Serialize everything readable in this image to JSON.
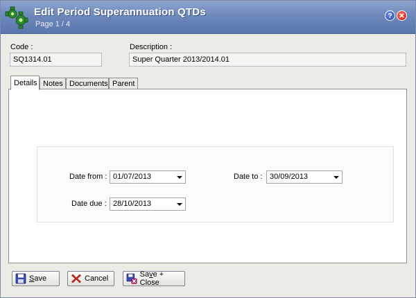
{
  "window": {
    "title": "Edit Period Superannuation QTDs",
    "subtitle": "Page 1 / 4",
    "help_symbol": "?",
    "close_symbol": "✕"
  },
  "form": {
    "code_label": "Code :",
    "code_value": "SQ1314.01",
    "description_label": "Description :",
    "description_value": "Super Quarter 2013/2014.01"
  },
  "tabs": [
    {
      "label": "Details",
      "active": true
    },
    {
      "label": "Notes",
      "active": false
    },
    {
      "label": "Documents",
      "active": false
    },
    {
      "label": "Parent",
      "active": false
    }
  ],
  "details": {
    "date_from_label": "Date from :",
    "date_from_value": "01/07/2013",
    "date_to_label": "Date to :",
    "date_to_value": "30/09/2013",
    "date_due_label": "Date due :",
    "date_due_value": "28/10/2013"
  },
  "buttons": {
    "save_mnemonic": "S",
    "save_rest": "ave",
    "cancel_label": "Cancel",
    "save_close_prefix": "Sa",
    "save_close_mnemonic": "v",
    "save_close_rest": "e + Close"
  },
  "icons": {
    "app": "green-gears-icon",
    "help": "help-icon",
    "close": "close-icon",
    "save": "floppy-disk-icon",
    "cancel": "red-x-icon",
    "save_close": "floppy-disk-close-icon",
    "dropdown": "chevron-down-icon"
  },
  "colors": {
    "titlebar": "#6d88bb",
    "window_bg": "#ecebe6",
    "cancel_red": "#d8261a"
  }
}
